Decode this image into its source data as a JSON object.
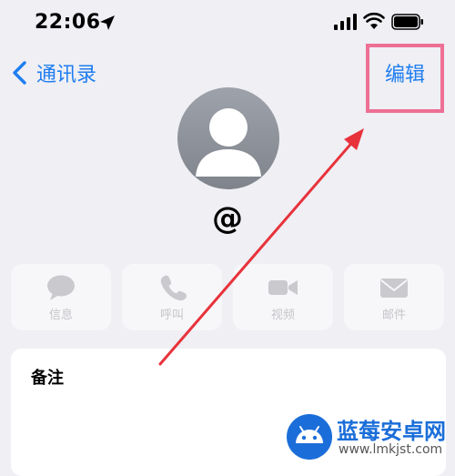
{
  "status_bar": {
    "time": "22:06",
    "icons": [
      "location-arrow-icon",
      "cellular-signal-icon",
      "wifi-icon",
      "battery-icon"
    ]
  },
  "nav": {
    "back_label": "通讯录",
    "edit_label": "编辑",
    "accent_color": "#1f7ef0",
    "highlight_color": "#ee6f94"
  },
  "contact": {
    "name": "@"
  },
  "actions": [
    {
      "label": "信息",
      "icon": "message-bubble-icon"
    },
    {
      "label": "呼叫",
      "icon": "phone-icon"
    },
    {
      "label": "视频",
      "icon": "video-camera-icon"
    },
    {
      "label": "邮件",
      "icon": "envelope-icon"
    }
  ],
  "notes": {
    "label": "备注"
  },
  "annotation": {
    "arrow_color": "#e8323b"
  },
  "watermark": {
    "title": "蓝莓安卓网",
    "url": "www.lmkjst.com"
  }
}
